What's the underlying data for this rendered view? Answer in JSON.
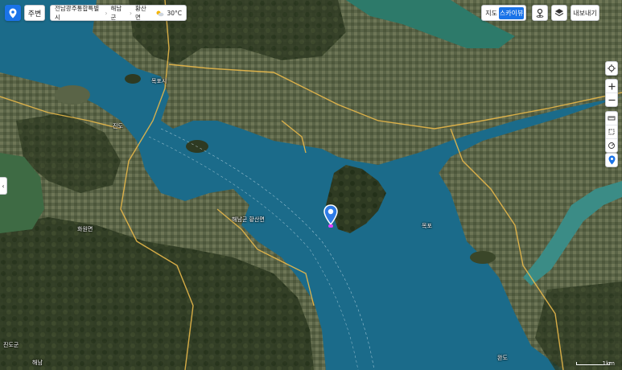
{
  "toolbar": {
    "around_label": "주변",
    "breadcrumb": [
      "전남광주통합특별시",
      "해남군",
      "황산면"
    ],
    "weather_temp": "30°C",
    "map_type": [
      "지도",
      "스카이뷰"
    ],
    "active_map_type": "스카이뷰",
    "export_label": "내보내기"
  },
  "labels": {
    "bay_label": "목포",
    "island_label": "해남군 황산면",
    "west_town": "진도",
    "town_mid": "화원면",
    "bottom_left": "진도군",
    "bottom_mid": "해남",
    "bottom_right": "완도",
    "north_town": "목포시"
  },
  "scale": {
    "text": "1km"
  },
  "icons": {
    "logo": "map-pin-logo-icon",
    "weather": "sun-cloud-icon",
    "roadview": "roadview-icon",
    "layers": "layers-icon",
    "locate": "crosshair-icon",
    "zoom_in": "plus-icon",
    "zoom_out": "minus-icon",
    "distance": "ruler-icon",
    "area": "area-icon",
    "radius": "radius-icon",
    "marker": "location-pin-icon",
    "collapse": "chevron-left-icon"
  },
  "colors": {
    "accent": "#1a73e8",
    "water": "#1b6b8a",
    "land": "#3d4a2e"
  }
}
